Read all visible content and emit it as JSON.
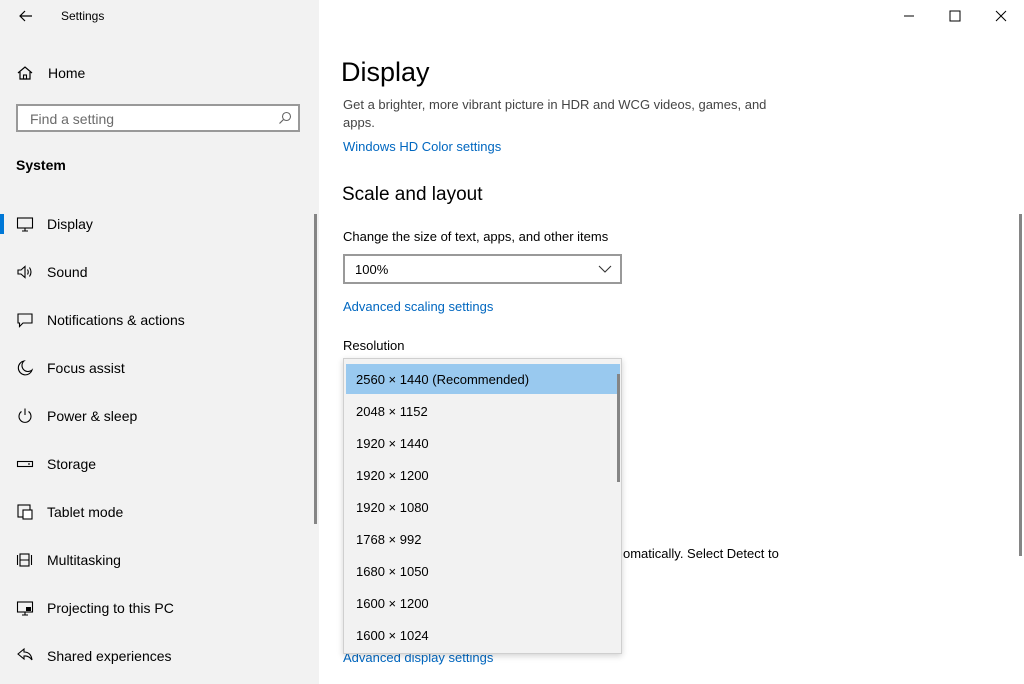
{
  "app_title": "Settings",
  "sidebar": {
    "home_label": "Home",
    "search_placeholder": "Find a setting",
    "section": "System",
    "items": [
      {
        "label": "Display",
        "icon": "monitor-icon"
      },
      {
        "label": "Sound",
        "icon": "speaker-icon"
      },
      {
        "label": "Notifications & actions",
        "icon": "notification-icon"
      },
      {
        "label": "Focus assist",
        "icon": "moon-icon"
      },
      {
        "label": "Power & sleep",
        "icon": "power-icon"
      },
      {
        "label": "Storage",
        "icon": "storage-icon"
      },
      {
        "label": "Tablet mode",
        "icon": "tablet-icon"
      },
      {
        "label": "Multitasking",
        "icon": "multitasking-icon"
      },
      {
        "label": "Projecting to this PC",
        "icon": "projecting-icon"
      },
      {
        "label": "Shared experiences",
        "icon": "shared-icon"
      }
    ]
  },
  "main": {
    "title": "Display",
    "hdr_description": "Get a brighter, more vibrant picture in HDR and WCG videos, games, and apps.",
    "hdr_link": "Windows HD Color settings",
    "scale_heading": "Scale and layout",
    "scale_label": "Change the size of text, apps, and other items",
    "scale_value": "100%",
    "advanced_scaling_link": "Advanced scaling settings",
    "resolution_label": "Resolution",
    "partial_text": "omatically. Select Detect to",
    "advanced_display_link": "Advanced display settings"
  },
  "resolution_options": [
    "2560 × 1440 (Recommended)",
    "2048 × 1152",
    "1920 × 1440",
    "1920 × 1200",
    "1920 × 1080",
    "1768 × 992",
    "1680 × 1050",
    "1600 × 1200",
    "1600 × 1024"
  ],
  "selected_resolution_index": 0,
  "colors": {
    "accent": "#0078d7",
    "link": "#0067c0",
    "selected_option": "#99c9ef",
    "sidebar_bg": "#f2f2f2"
  }
}
